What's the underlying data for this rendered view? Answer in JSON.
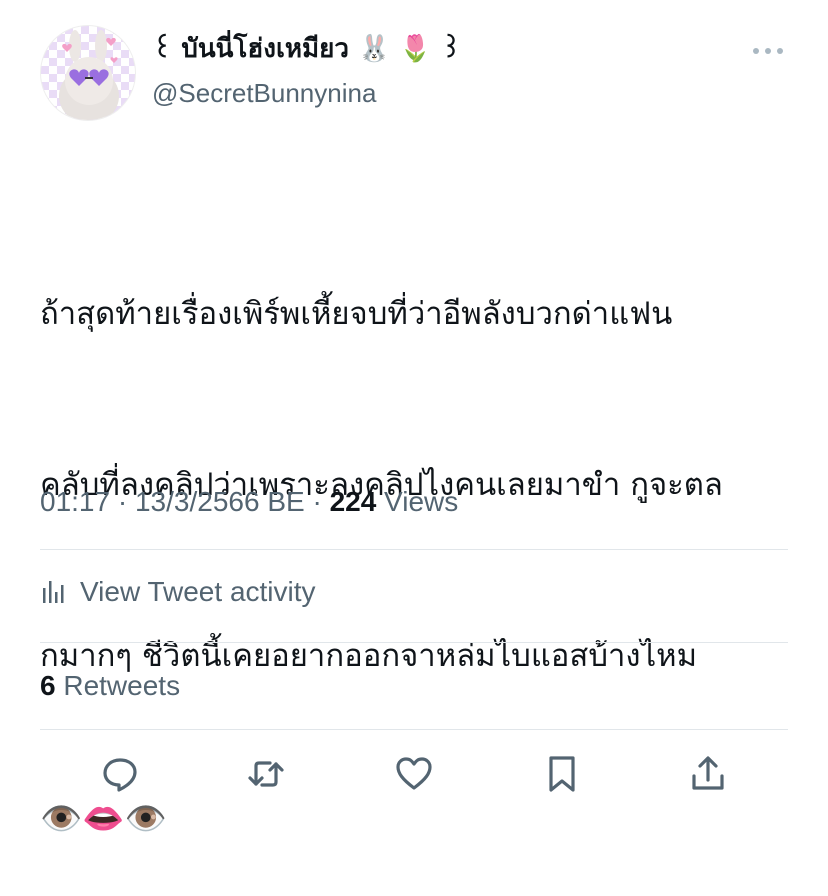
{
  "profile": {
    "display_name": "꒰ บันนี่โฮ่งเหมียว 🐰 🌷 ꒱",
    "handle": "@SecretBunnynina",
    "more_label": "more-options"
  },
  "tweet": {
    "lines": [
      "ถ้าสุดท้ายเรื่องเพิร์พเหี้ยจบที่ว่าอีพลังบวกด่าแฟน",
      "คลับที่ลงคลิปว่าเพราะลงคลิปไงคนเลยมาขำ กูจะตล",
      "กมากๆ ชีวิตนี้เคยอยากออกจาหล่มไบแอสบ้างไหม",
      "👁️👄👁️"
    ]
  },
  "meta": {
    "time": "01:17",
    "separator": " · ",
    "date": "13/3/2566 BE",
    "views_count": "224",
    "views_label": " Views"
  },
  "activity": {
    "label": "View Tweet activity",
    "icon": "analytics-bars-icon"
  },
  "retweets": {
    "count": "6",
    "label": " Retweets"
  },
  "actions": [
    {
      "name": "reply",
      "icon": "reply-icon"
    },
    {
      "name": "retweet",
      "icon": "retweet-icon"
    },
    {
      "name": "like",
      "icon": "heart-icon"
    },
    {
      "name": "bookmark",
      "icon": "bookmark-icon"
    },
    {
      "name": "share",
      "icon": "share-icon"
    }
  ],
  "colors": {
    "text_primary": "#0f1419",
    "text_secondary": "#536471",
    "divider": "#e1e6ea"
  }
}
